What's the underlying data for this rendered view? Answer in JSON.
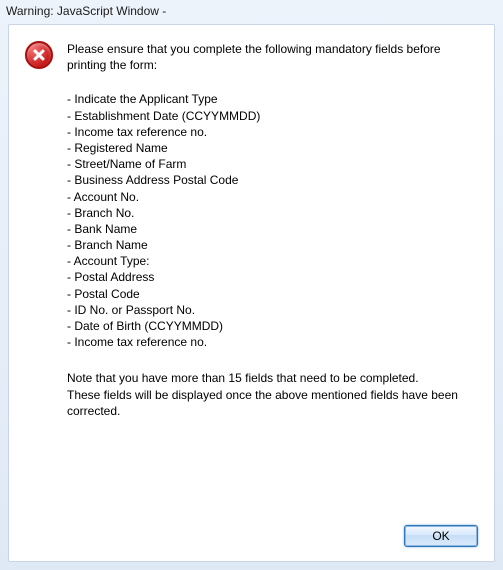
{
  "titlebar": {
    "text": "Warning: JavaScript Window -"
  },
  "message": {
    "intro": "Please ensure that you complete the following mandatory fields before printing the form:",
    "fields": [
      "Indicate the Applicant Type",
      "Establishment Date (CCYYMMDD)",
      "Income tax reference no.",
      "Registered Name",
      "Street/Name of Farm",
      "Business Address Postal Code",
      "Account No.",
      "Branch No.",
      "Bank Name",
      "Branch Name",
      "Account Type:",
      "Postal Address",
      "Postal Code",
      "ID No. or Passport No.",
      "Date of Birth (CCYYMMDD)",
      "Income tax reference no."
    ],
    "note_line1": "Note that you have more than 15 fields that need to be completed.",
    "note_line2": "These fields will be displayed once the above mentioned fields have been corrected."
  },
  "buttons": {
    "ok": "OK"
  }
}
